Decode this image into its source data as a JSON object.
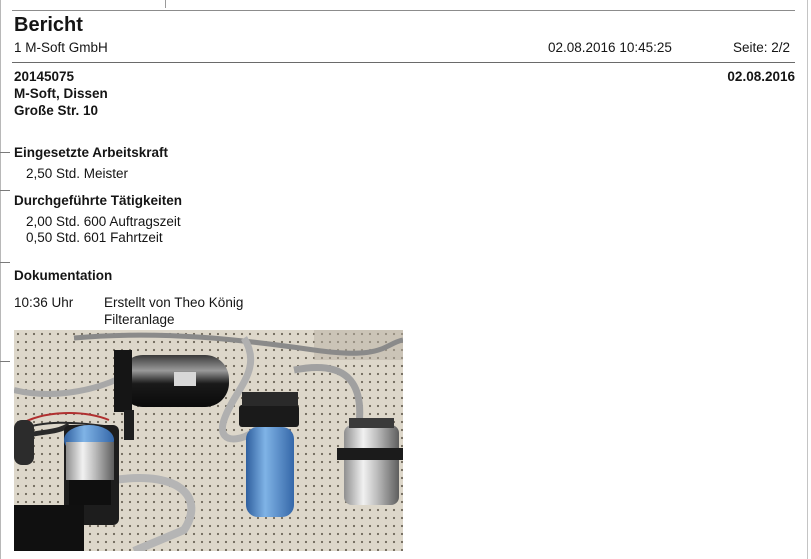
{
  "header": {
    "title": "Bericht",
    "company": "1 M-Soft GmbH",
    "datetime": "02.08.2016 10:45:25",
    "page": "Seite: 2/2"
  },
  "order": {
    "number": "20145075",
    "customer": "M-Soft, Dissen",
    "street": "Große Str. 10",
    "date": "02.08.2016"
  },
  "workforce": {
    "heading": "Eingesetzte Arbeitskraft",
    "lines": [
      "2,50 Std. Meister"
    ]
  },
  "activities": {
    "heading": "Durchgeführte Tätigkeiten",
    "lines": [
      "2,00 Std. 600 Auftragszeit",
      "0,50 Std. 601 Fahrtzeit"
    ]
  },
  "documentation": {
    "heading": "Dokumentation",
    "time": "10:36 Uhr",
    "author": "Erstellt von Theo König",
    "caption": "Filteranlage"
  }
}
